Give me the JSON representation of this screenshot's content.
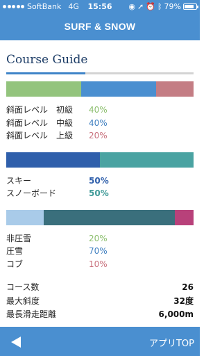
{
  "status_bar": {
    "carrier": "SoftBank",
    "network": "4G",
    "time": "15:56",
    "battery": "79%",
    "battery_level": 0.79
  },
  "header": {
    "title": "SURF & SNOW"
  },
  "section": {
    "title": "Course Guide"
  },
  "slope_levels": {
    "bar": [
      {
        "name": "初級",
        "percent": 40,
        "color": "#93c47d"
      },
      {
        "name": "中級",
        "percent": 40,
        "color": "#4a8fd0"
      },
      {
        "name": "上級",
        "percent": 20,
        "color": "#c47d84"
      }
    ],
    "rows": [
      {
        "label": "斜面レベル　初級",
        "value": "40%",
        "color": "#8cbf6e"
      },
      {
        "label": "斜面レベル　中級",
        "value": "40%",
        "color": "#3f7fc0"
      },
      {
        "label": "斜面レベル　上級",
        "value": "20%",
        "color": "#c9717d"
      }
    ]
  },
  "ski_board": {
    "bar": [
      {
        "name": "スキー",
        "percent": 50,
        "color": "#2f5fab"
      },
      {
        "name": "スノーボード",
        "percent": 50,
        "color": "#4aa3a2"
      }
    ],
    "rows": [
      {
        "label": "スキー",
        "value": "50%",
        "color": "#2f5fab"
      },
      {
        "label": "スノーボード",
        "value": "50%",
        "color": "#3f9a98"
      }
    ]
  },
  "snow_condition": {
    "bar": [
      {
        "name": "非圧雪",
        "percent": 20,
        "color": "#a9cbe9"
      },
      {
        "name": "圧雪",
        "percent": 70,
        "color": "#3a6f7c"
      },
      {
        "name": "コブ",
        "percent": 10,
        "color": "#b8417a"
      }
    ],
    "rows": [
      {
        "label": "非圧雪",
        "value": "20%",
        "color": "#8cbf6e"
      },
      {
        "label": "圧雪",
        "value": "70%",
        "color": "#3f7fc0"
      },
      {
        "label": "コブ",
        "value": "10%",
        "color": "#c9717d"
      }
    ]
  },
  "stats": [
    {
      "label": "コース数",
      "value": "26"
    },
    {
      "label": "最大斜度",
      "value": "32度"
    },
    {
      "label": "最長滑走距離",
      "value": "6,000m"
    }
  ],
  "footer": {
    "back_icon": "back-arrow-icon",
    "top_label": "アプリTOP"
  },
  "colors": {
    "brand": "#4a8fd0",
    "title": "#1c3c66"
  }
}
